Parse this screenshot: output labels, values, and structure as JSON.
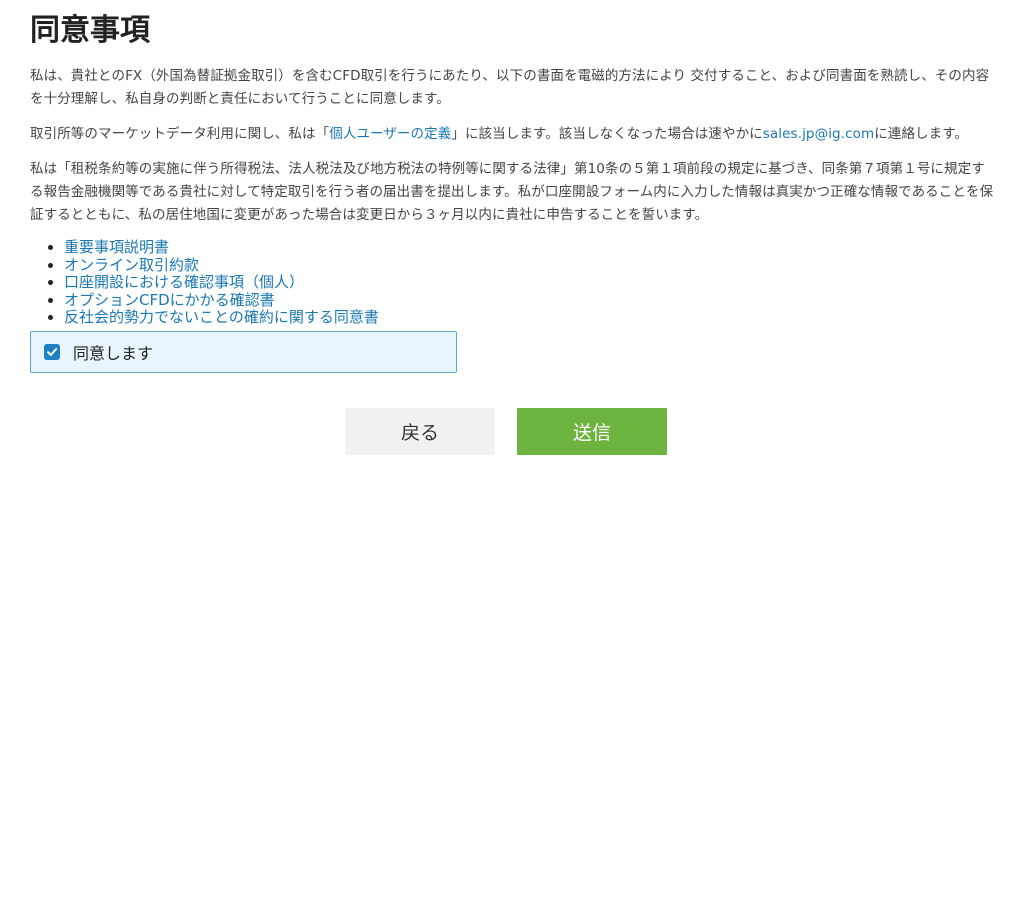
{
  "page": {
    "title": "同意事項"
  },
  "paragraphs": {
    "p1": "私は、貴社とのFX（外国為替証拠金取引）を含むCFD取引を行うにあたり、以下の書面を電磁的方法により 交付すること、および同書面を熟読し、その内容を十分理解し、私自身の判断と責任において行うことに同意します。",
    "p2_before": "取引所等のマーケットデータ利用に関し、私は「",
    "p2_link": "個人ユーザーの定義",
    "p2_middle": "」に該当します。該当しなくなった場合は速やかに",
    "p2_email": "sales.jp@ig.com",
    "p2_after": "に連絡します。",
    "p3": "私は「租税条約等の実施に伴う所得税法、法人税法及び地方税法の特例等に関する法律」第10条の５第１項前段の規定に基づき、同条第７項第１号に規定する報告金融機関等である貴社に対して特定取引を行う者の届出書を提出します。私が口座開設フォーム内に入力した情報は真実かつ正確な情報であることを保証するとともに、私の居住地国に変更があった場合は変更日から３ヶ月以内に貴社に申告することを誓います。"
  },
  "documents": [
    {
      "label": "重要事項説明書"
    },
    {
      "label": "オンライン取引約款"
    },
    {
      "label": "口座開設における確認事項（個人）"
    },
    {
      "label": "オプションCFDにかかる確認書"
    },
    {
      "label": "反社会的勢力でないことの確約に関する同意書"
    }
  ],
  "agreement": {
    "label": "同意します",
    "checked": true
  },
  "buttons": {
    "back_label": "戻る",
    "submit_label": "送信"
  },
  "colors": {
    "link": "#1a78b4",
    "checkbox": "#1e80c1",
    "submit": "#6db33f",
    "agree_bg": "#e8f5fd"
  }
}
